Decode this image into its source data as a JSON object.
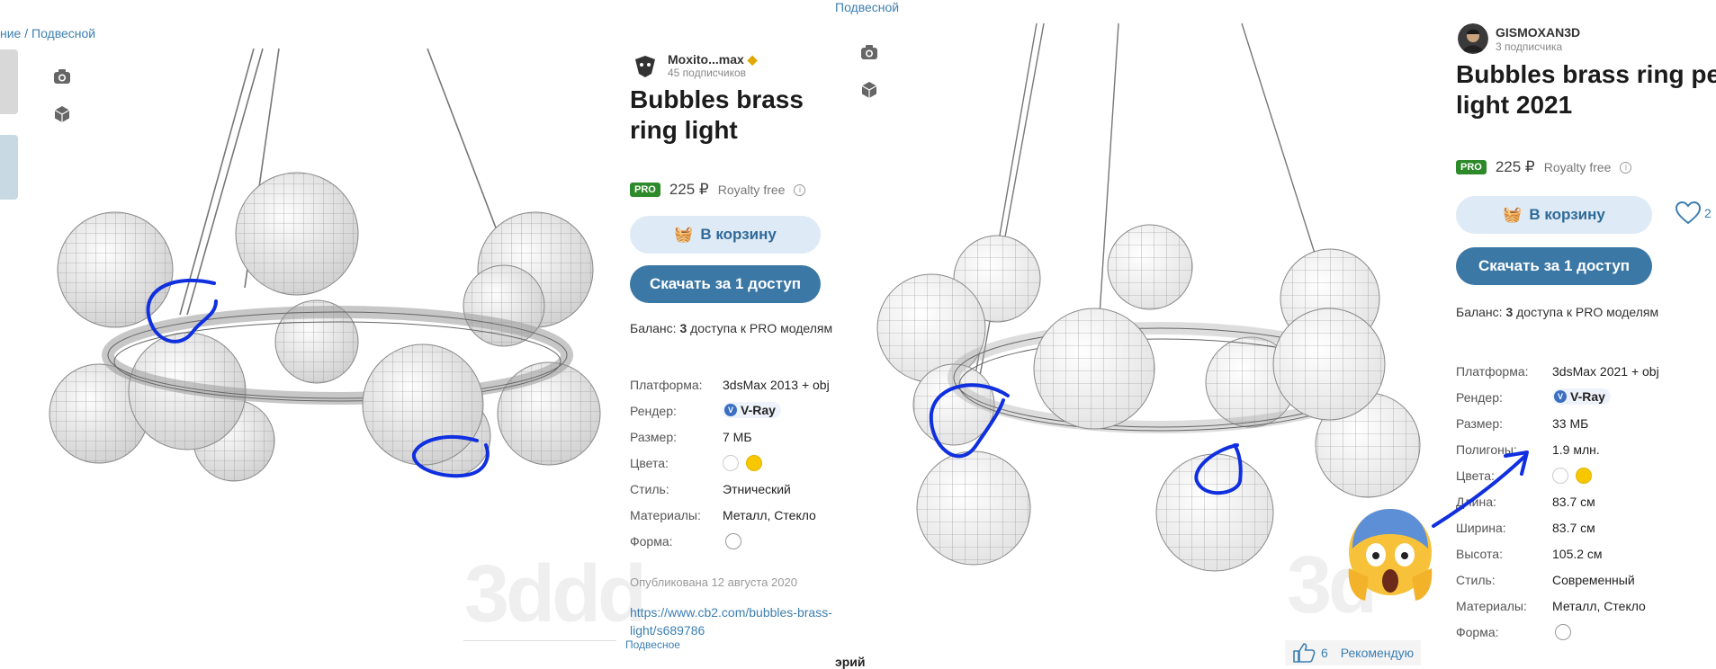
{
  "left": {
    "breadcrumb": "ние / Подвесной",
    "author": {
      "name": "Moxito...max",
      "subscribers": "45 подписчиков"
    },
    "title": "Bubbles brass ring light",
    "badge": "PRO",
    "price": "225 ₽",
    "license": "Royalty free",
    "cart_button": "В корзину",
    "download_button": "Скачать за 1 доступ",
    "balance_prefix": "Баланс:",
    "balance_count": "3",
    "balance_suffix": "доступа к PRO моделям",
    "specs": {
      "platform_label": "Платформа:",
      "platform": "3dsMax 2013 + obj",
      "render_label": "Рендер:",
      "render": "V-Ray",
      "size_label": "Размер:",
      "size": "7 МБ",
      "colors_label": "Цвета:",
      "style_label": "Стиль:",
      "style": "Этнический",
      "materials_label": "Материалы:",
      "materials": "Металл, Стекло",
      "shape_label": "Форма:"
    },
    "published": "Опубликована 12 августа 2020",
    "source_link_1": "https://www.cb2.com/bubbles-brass-",
    "source_link_2": "light/s689786",
    "watermark": "3ddd",
    "bottom_crumb": "Подвесное"
  },
  "right": {
    "breadcrumb": "Подвесной",
    "author": {
      "name": "GISMOXAN3D",
      "subscribers": "3 подписчика"
    },
    "title_line1": "Bubbles brass ring pen",
    "title_line2": "light 2021",
    "badge": "PRO",
    "price": "225 ₽",
    "license": "Royalty free",
    "cart_button": "В корзину",
    "like_count": "2",
    "download_button": "Скачать за 1 доступ",
    "balance_prefix": "Баланс:",
    "balance_count": "3",
    "balance_suffix": "доступа к PRO моделям",
    "specs": {
      "platform_label": "Платформа:",
      "platform": "3dsMax 2021 + obj",
      "render_label": "Рендер:",
      "render": "V-Ray",
      "size_label": "Размер:",
      "size": "33 МБ",
      "polygons_label": "Полигоны:",
      "polygons": "1.9 млн.",
      "colors_label": "Цвета:",
      "length_label": "Длина:",
      "length": "83.7 см",
      "width_label": "Ширина:",
      "width": "83.7 см",
      "height_label": "Высота:",
      "height": "105.2 см",
      "style_label": "Стиль:",
      "style": "Современный",
      "materials_label": "Материалы:",
      "materials": "Металл, Стекло",
      "shape_label": "Форма:"
    },
    "recommend_count": "6",
    "recommend_label": "Рекомендую",
    "bottom_text": "эрий",
    "watermark": "3d"
  },
  "colors": {
    "accent": "#3c78a6",
    "pro": "#2d8a2a",
    "annotation": "#1030e0",
    "gold": "#f7c800"
  }
}
